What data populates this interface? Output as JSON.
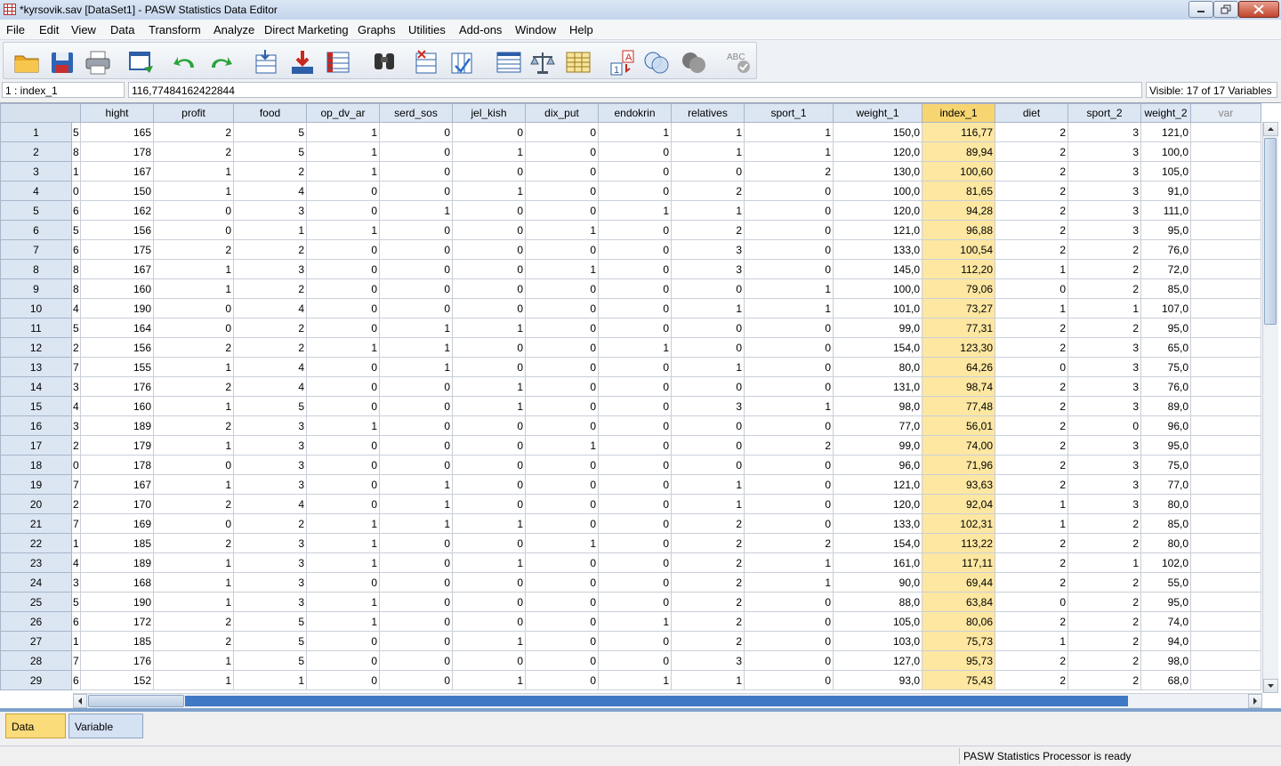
{
  "window": {
    "title": "*kyrsovik.sav [DataSet1] - PASW Statistics Data Editor"
  },
  "menu": [
    "File",
    "Edit",
    "View",
    "Data",
    "Transform",
    "Analyze",
    "Direct Marketing",
    "Graphs",
    "Utilities",
    "Add-ons",
    "Window",
    "Help"
  ],
  "toolbar": {
    "icons": [
      "open-folder-icon",
      "save-icon",
      "print-icon",
      "recall-dialog-icon",
      "undo-icon",
      "redo-icon",
      "goto-case-icon",
      "goto-variable-icon",
      "variables-icon",
      "find-icon",
      "insert-cases-icon",
      "insert-variable-icon",
      "split-file-icon",
      "weight-cases-icon",
      "select-cases-icon",
      "value-labels-icon",
      "use-sets-icon",
      "show-all-variables-icon",
      "spell-check-icon"
    ]
  },
  "cellbar": {
    "name": "1 : index_1",
    "value": "116,77484162422844",
    "visible": "Visible: 17 of 17 Variables"
  },
  "grid": {
    "columns": [
      "hight",
      "profit",
      "food",
      "op_dv_ar",
      "serd_sos",
      "jel_kish",
      "dix_put",
      "endokrin",
      "relatives",
      "sport_1",
      "weight_1",
      "index_1",
      "diet",
      "sport_2",
      "weight_2",
      "var"
    ],
    "selected_column": "index_1",
    "rows": [
      {
        "n": "1",
        "pre": "5",
        "v": [
          "165",
          "2",
          "5",
          "1",
          "0",
          "0",
          "0",
          "1",
          "1",
          "1",
          "150,0",
          "116,77",
          "2",
          "3",
          "121,0"
        ]
      },
      {
        "n": "2",
        "pre": "8",
        "v": [
          "178",
          "2",
          "5",
          "1",
          "0",
          "1",
          "0",
          "0",
          "1",
          "1",
          "120,0",
          "89,94",
          "2",
          "3",
          "100,0"
        ]
      },
      {
        "n": "3",
        "pre": "1",
        "v": [
          "167",
          "1",
          "2",
          "1",
          "0",
          "0",
          "0",
          "0",
          "0",
          "2",
          "130,0",
          "100,60",
          "2",
          "3",
          "105,0"
        ]
      },
      {
        "n": "4",
        "pre": "0",
        "v": [
          "150",
          "1",
          "4",
          "0",
          "0",
          "1",
          "0",
          "0",
          "2",
          "0",
          "100,0",
          "81,65",
          "2",
          "3",
          "91,0"
        ]
      },
      {
        "n": "5",
        "pre": "6",
        "v": [
          "162",
          "0",
          "3",
          "0",
          "1",
          "0",
          "0",
          "1",
          "1",
          "0",
          "120,0",
          "94,28",
          "2",
          "3",
          "111,0"
        ]
      },
      {
        "n": "6",
        "pre": "5",
        "v": [
          "156",
          "0",
          "1",
          "1",
          "0",
          "0",
          "1",
          "0",
          "2",
          "0",
          "121,0",
          "96,88",
          "2",
          "3",
          "95,0"
        ]
      },
      {
        "n": "7",
        "pre": "6",
        "v": [
          "175",
          "2",
          "2",
          "0",
          "0",
          "0",
          "0",
          "0",
          "3",
          "0",
          "133,0",
          "100,54",
          "2",
          "2",
          "76,0"
        ]
      },
      {
        "n": "8",
        "pre": "8",
        "v": [
          "167",
          "1",
          "3",
          "0",
          "0",
          "0",
          "1",
          "0",
          "3",
          "0",
          "145,0",
          "112,20",
          "1",
          "2",
          "72,0"
        ]
      },
      {
        "n": "9",
        "pre": "8",
        "v": [
          "160",
          "1",
          "2",
          "0",
          "0",
          "0",
          "0",
          "0",
          "0",
          "1",
          "100,0",
          "79,06",
          "0",
          "2",
          "85,0"
        ]
      },
      {
        "n": "10",
        "pre": "4",
        "v": [
          "190",
          "0",
          "4",
          "0",
          "0",
          "0",
          "0",
          "0",
          "1",
          "1",
          "101,0",
          "73,27",
          "1",
          "1",
          "107,0"
        ]
      },
      {
        "n": "11",
        "pre": "5",
        "v": [
          "164",
          "0",
          "2",
          "0",
          "1",
          "1",
          "0",
          "0",
          "0",
          "0",
          "99,0",
          "77,31",
          "2",
          "2",
          "95,0"
        ]
      },
      {
        "n": "12",
        "pre": "2",
        "v": [
          "156",
          "2",
          "2",
          "1",
          "1",
          "0",
          "0",
          "1",
          "0",
          "0",
          "154,0",
          "123,30",
          "2",
          "3",
          "65,0"
        ]
      },
      {
        "n": "13",
        "pre": "7",
        "v": [
          "155",
          "1",
          "4",
          "0",
          "1",
          "0",
          "0",
          "0",
          "1",
          "0",
          "80,0",
          "64,26",
          "0",
          "3",
          "75,0"
        ]
      },
      {
        "n": "14",
        "pre": "3",
        "v": [
          "176",
          "2",
          "4",
          "0",
          "0",
          "1",
          "0",
          "0",
          "0",
          "0",
          "131,0",
          "98,74",
          "2",
          "3",
          "76,0"
        ]
      },
      {
        "n": "15",
        "pre": "4",
        "v": [
          "160",
          "1",
          "5",
          "0",
          "0",
          "1",
          "0",
          "0",
          "3",
          "1",
          "98,0",
          "77,48",
          "2",
          "3",
          "89,0"
        ]
      },
      {
        "n": "16",
        "pre": "3",
        "v": [
          "189",
          "2",
          "3",
          "1",
          "0",
          "0",
          "0",
          "0",
          "0",
          "0",
          "77,0",
          "56,01",
          "2",
          "0",
          "96,0"
        ]
      },
      {
        "n": "17",
        "pre": "2",
        "v": [
          "179",
          "1",
          "3",
          "0",
          "0",
          "0",
          "1",
          "0",
          "0",
          "2",
          "99,0",
          "74,00",
          "2",
          "3",
          "95,0"
        ]
      },
      {
        "n": "18",
        "pre": "0",
        "v": [
          "178",
          "0",
          "3",
          "0",
          "0",
          "0",
          "0",
          "0",
          "0",
          "0",
          "96,0",
          "71,96",
          "2",
          "3",
          "75,0"
        ]
      },
      {
        "n": "19",
        "pre": "7",
        "v": [
          "167",
          "1",
          "3",
          "0",
          "1",
          "0",
          "0",
          "0",
          "1",
          "0",
          "121,0",
          "93,63",
          "2",
          "3",
          "77,0"
        ]
      },
      {
        "n": "20",
        "pre": "2",
        "v": [
          "170",
          "2",
          "4",
          "0",
          "1",
          "0",
          "0",
          "0",
          "1",
          "0",
          "120,0",
          "92,04",
          "1",
          "3",
          "80,0"
        ]
      },
      {
        "n": "21",
        "pre": "7",
        "v": [
          "169",
          "0",
          "2",
          "1",
          "1",
          "1",
          "0",
          "0",
          "2",
          "0",
          "133,0",
          "102,31",
          "1",
          "2",
          "85,0"
        ]
      },
      {
        "n": "22",
        "pre": "1",
        "v": [
          "185",
          "2",
          "3",
          "1",
          "0",
          "0",
          "1",
          "0",
          "2",
          "2",
          "154,0",
          "113,22",
          "2",
          "2",
          "80,0"
        ]
      },
      {
        "n": "23",
        "pre": "4",
        "v": [
          "189",
          "1",
          "3",
          "1",
          "0",
          "1",
          "0",
          "0",
          "2",
          "1",
          "161,0",
          "117,11",
          "2",
          "1",
          "102,0"
        ]
      },
      {
        "n": "24",
        "pre": "3",
        "v": [
          "168",
          "1",
          "3",
          "0",
          "0",
          "0",
          "0",
          "0",
          "2",
          "1",
          "90,0",
          "69,44",
          "2",
          "2",
          "55,0"
        ]
      },
      {
        "n": "25",
        "pre": "5",
        "v": [
          "190",
          "1",
          "3",
          "1",
          "0",
          "0",
          "0",
          "0",
          "2",
          "0",
          "88,0",
          "63,84",
          "0",
          "2",
          "95,0"
        ]
      },
      {
        "n": "26",
        "pre": "6",
        "v": [
          "172",
          "2",
          "5",
          "1",
          "0",
          "0",
          "0",
          "1",
          "2",
          "0",
          "105,0",
          "80,06",
          "2",
          "2",
          "74,0"
        ]
      },
      {
        "n": "27",
        "pre": "1",
        "v": [
          "185",
          "2",
          "5",
          "0",
          "0",
          "1",
          "0",
          "0",
          "2",
          "0",
          "103,0",
          "75,73",
          "1",
          "2",
          "94,0"
        ]
      },
      {
        "n": "28",
        "pre": "7",
        "v": [
          "176",
          "1",
          "5",
          "0",
          "0",
          "0",
          "0",
          "0",
          "3",
          "0",
          "127,0",
          "95,73",
          "2",
          "2",
          "98,0"
        ]
      },
      {
        "n": "29",
        "pre": "6",
        "v": [
          "152",
          "1",
          "1",
          "0",
          "0",
          "1",
          "0",
          "1",
          "1",
          "0",
          "93,0",
          "75,43",
          "2",
          "2",
          "68,0"
        ]
      }
    ]
  },
  "tabs": {
    "data_view": "Data View",
    "variable_view": "Variable View"
  },
  "status": {
    "text": "PASW Statistics Processor is ready"
  },
  "colors": {
    "selected_header": "#f7d571",
    "selected_cells": "#fde7a1",
    "active_tab": "#fbdc7a"
  }
}
